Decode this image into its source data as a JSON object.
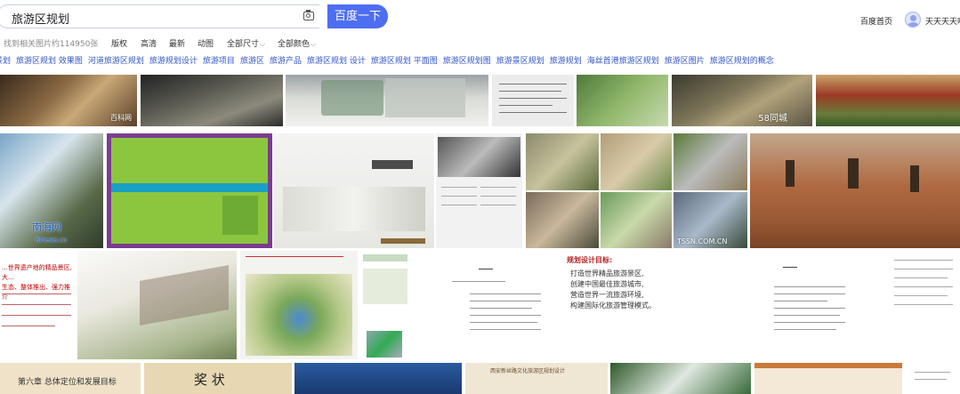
{
  "search": {
    "query": "旅游区规划",
    "button_label": "百度一下"
  },
  "header": {
    "home_link": "百度首页",
    "username": "天天天天嘟"
  },
  "filters": {
    "result_count": "找到相关图片约114950张",
    "options": [
      "版权",
      "高清",
      "最新",
      "动图",
      "全部尺寸",
      "全部颜色"
    ]
  },
  "related_searches": [
    "景划",
    "旅游区规划 效果图",
    "河道旅游区规划",
    "旅游规划设计",
    "旅游项目",
    "旅游区",
    "旅游产品",
    "旅游区规划 设计",
    "旅游区规划 平面图",
    "旅游区规划图",
    "旅游景区规划",
    "旅游规划",
    "海丝首港旅游区规划",
    "旅游区图片",
    "旅游区规划的概念"
  ],
  "images": {
    "wm_r1_1": "百科网",
    "wm_r1_7": "58同城",
    "wm_r2_1": "南海网",
    "wm_r2_1b": "hinews.cn",
    "wm_r2_6": "TSSN.COM.CN",
    "doc_r3_5_title": "规划设计目标:",
    "doc_r3_5_lines": [
      "打造世界精品旅游景区,",
      "创建中国最佳旅游城市,",
      "营造世界一流旅游环境,",
      "构建国际化旅游管理模式。"
    ],
    "r4_1_title": "第六章 总体定位和发展目标",
    "r4_2_title": "奖  状",
    "r4_4_title": "西安新丝路文化旅游区规划设计"
  },
  "colors": {
    "brand_blue": "#4e6ef2",
    "link_blue": "#3154c8"
  }
}
